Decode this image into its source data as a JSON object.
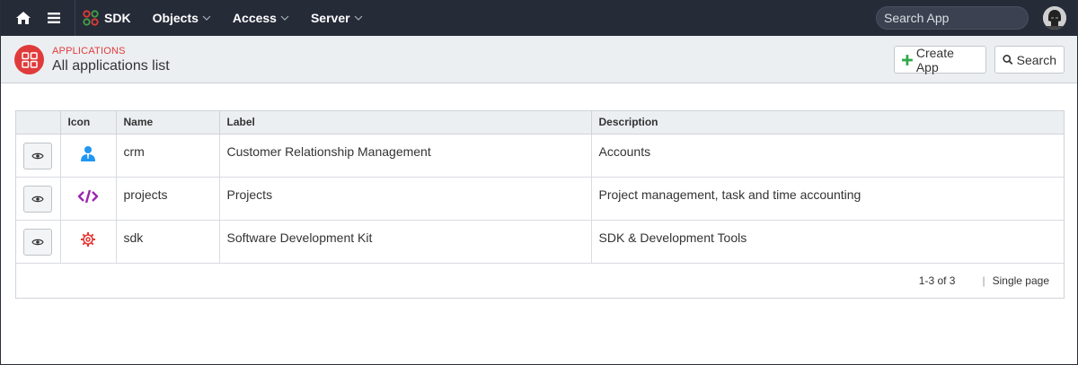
{
  "navbar": {
    "brand_label": "SDK",
    "menus": [
      {
        "label": "Objects"
      },
      {
        "label": "Access"
      },
      {
        "label": "Server"
      }
    ],
    "search_placeholder": "Search App"
  },
  "header": {
    "breadcrumb": "APPLICATIONS",
    "title": "All applications list",
    "create_label": "Create App",
    "search_label": "Search"
  },
  "table": {
    "columns": {
      "view": "",
      "icon": "Icon",
      "name": "Name",
      "label": "Label",
      "description": "Description"
    },
    "rows": [
      {
        "icon": "user-icon",
        "icon_color": "#2196f3",
        "name": "crm",
        "label": "Customer Relationship Management",
        "description": "Accounts"
      },
      {
        "icon": "code-icon",
        "icon_color": "#9c27b0",
        "name": "projects",
        "label": "Projects",
        "description": "Project management, task and time accounting"
      },
      {
        "icon": "gear-icon",
        "icon_color": "#e53935",
        "name": "sdk",
        "label": "Software Development Kit",
        "description": "SDK & Development Tools"
      }
    ]
  },
  "pager": {
    "count_text": "1-3 of 3",
    "separator": "|",
    "mode_text": "Single page"
  },
  "colors": {
    "navbar_bg": "#262b38",
    "accent_red": "#e03b3b",
    "create_plus": "#2ea84a"
  }
}
